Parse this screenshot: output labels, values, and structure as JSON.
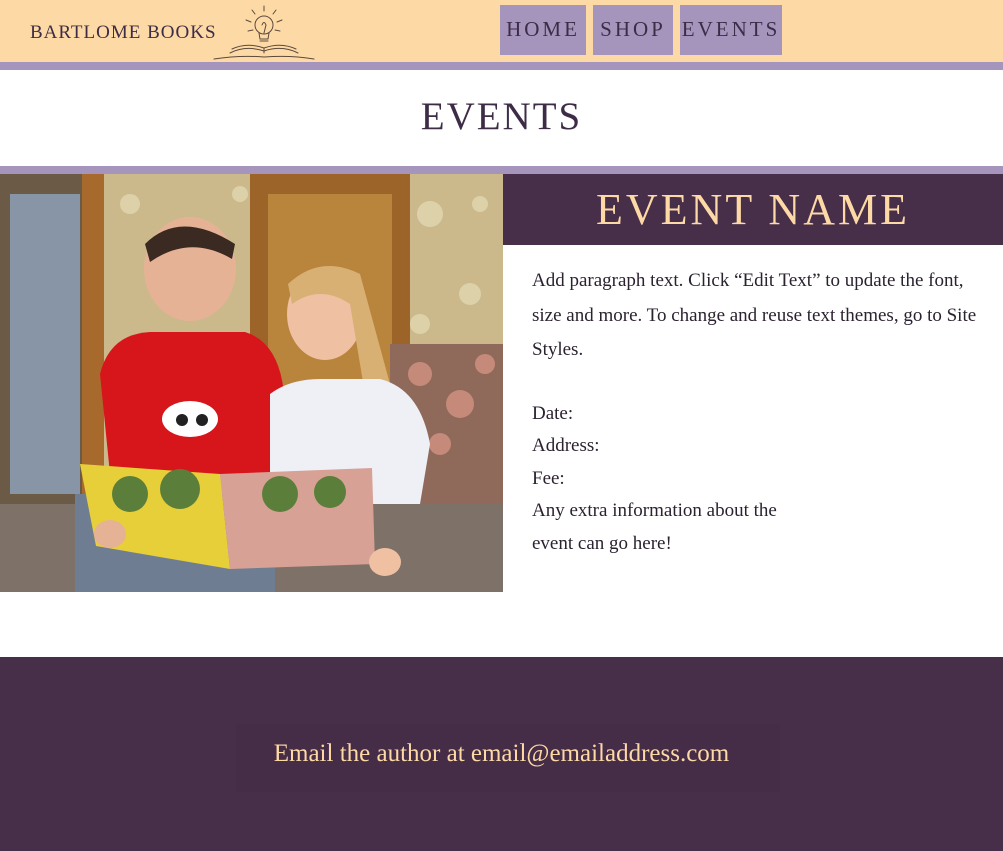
{
  "header": {
    "brand": "BARTLOME BOOKS",
    "logo_icon": "lightbulb-book-icon",
    "nav": [
      {
        "label": "HOME"
      },
      {
        "label": "SHOP"
      },
      {
        "label": "EVENTS"
      }
    ]
  },
  "page": {
    "title": "EVENTS"
  },
  "event": {
    "image_icon": "children-reading-photo",
    "name": "EVENT NAME",
    "description": "Add paragraph text. Click “Edit Text” to update the font, size and more. To change and reuse text themes, go to Site Styles.",
    "date_label": "Date:",
    "address_label": "Address:",
    "fee_label": "Fee:",
    "extra": "Any extra information about the event can go here!"
  },
  "footer": {
    "prefix": "Email the author at ",
    "email": "email@emailaddress.com"
  },
  "colors": {
    "header_bg": "#fdd9a6",
    "accent_lavender": "#a595bd",
    "plum": "#472e49",
    "text_dark": "#3d2c46"
  }
}
